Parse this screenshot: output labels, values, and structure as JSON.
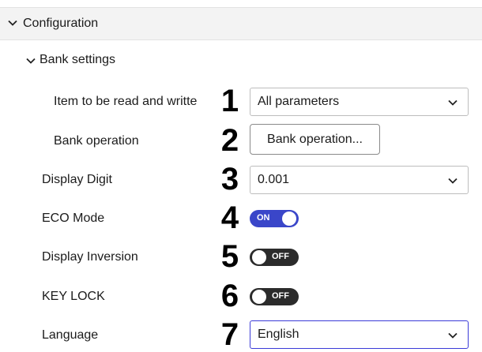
{
  "configuration": {
    "label": "Configuration"
  },
  "bank_settings": {
    "label": "Bank settings"
  },
  "rows": {
    "item_rw": {
      "label": "Item to be read and writte",
      "number": "1",
      "value": "All parameters"
    },
    "bank_operation": {
      "label": "Bank operation",
      "number": "2",
      "button": "Bank operation..."
    },
    "display_digit": {
      "label": "Display Digit",
      "number": "3",
      "value": "0.001"
    },
    "eco_mode": {
      "label": "ECO Mode",
      "number": "4",
      "state": "ON"
    },
    "display_inversion": {
      "label": "Display Inversion",
      "number": "5",
      "state": "OFF"
    },
    "key_lock": {
      "label": "KEY LOCK",
      "number": "6",
      "state": "OFF"
    },
    "language": {
      "label": "Language",
      "number": "7",
      "value": "English"
    }
  },
  "icons": {
    "expand": "chevron-down-icon",
    "dropdown": "chevron-down-icon"
  },
  "colors": {
    "toggle_on": "#3a46c9",
    "toggle_off": "#2b2b2b",
    "focus_border": "#3b3bd8",
    "header_bg": "#f3f3f3"
  }
}
